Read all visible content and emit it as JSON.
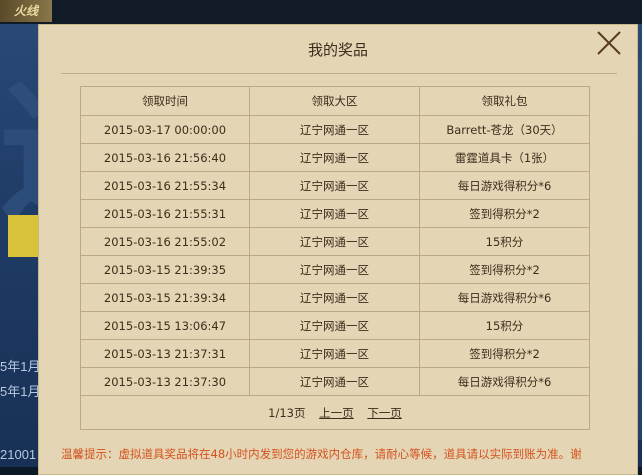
{
  "background": {
    "logo_text": "火线",
    "big_glyph": "辽",
    "side_line_1": "5年1月",
    "side_line_2": "5年1月",
    "side_line_3": "21001"
  },
  "dialog": {
    "title": "我的奖品",
    "columns": [
      "领取时间",
      "领取大区",
      "领取礼包"
    ],
    "rows": [
      {
        "time": "2015-03-17 00:00:00",
        "region": "辽宁网通一区",
        "package": "Barrett-苍龙（30天）"
      },
      {
        "time": "2015-03-16 21:56:40",
        "region": "辽宁网通一区",
        "package": "雷霆道具卡（1张）"
      },
      {
        "time": "2015-03-16 21:55:34",
        "region": "辽宁网通一区",
        "package": "每日游戏得积分*6"
      },
      {
        "time": "2015-03-16 21:55:31",
        "region": "辽宁网通一区",
        "package": "签到得积分*2"
      },
      {
        "time": "2015-03-16 21:55:02",
        "region": "辽宁网通一区",
        "package": "15积分"
      },
      {
        "time": "2015-03-15 21:39:35",
        "region": "辽宁网通一区",
        "package": "签到得积分*2"
      },
      {
        "time": "2015-03-15 21:39:34",
        "region": "辽宁网通一区",
        "package": "每日游戏得积分*6"
      },
      {
        "time": "2015-03-15 13:06:47",
        "region": "辽宁网通一区",
        "package": "15积分"
      },
      {
        "time": "2015-03-13 21:37:31",
        "region": "辽宁网通一区",
        "package": "签到得积分*2"
      },
      {
        "time": "2015-03-13 21:37:30",
        "region": "辽宁网通一区",
        "package": "每日游戏得积分*6"
      }
    ],
    "pager": {
      "page_info": "1/13页",
      "prev": "上一页",
      "next": "下一页"
    },
    "notice": "温馨提示：虚拟道具奖品将在48小时内发到您的游戏内仓库，请耐心等候，道具请以实际到账为准。谢"
  }
}
